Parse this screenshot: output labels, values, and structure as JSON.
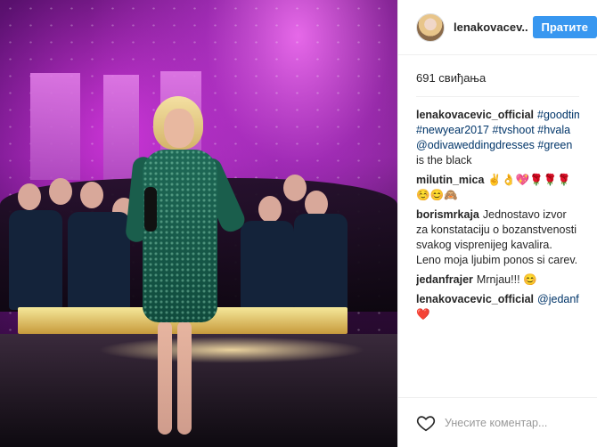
{
  "header": {
    "username": "lenakovacev...",
    "follow_label": "Пратите"
  },
  "likes_text": "691 свиђања",
  "comments": [
    {
      "user": "lenakovacevic_official",
      "parts": [
        {
          "t": "tag",
          "v": "#goodtimes"
        },
        {
          "t": "tag",
          "v": "#newyear2017"
        },
        {
          "t": "tag",
          "v": "#tvshoot"
        },
        {
          "t": "tag",
          "v": "#hvala"
        },
        {
          "t": "tag",
          "v": "@odivaweddingdresses"
        },
        {
          "t": "tag",
          "v": "#green"
        },
        {
          "t": "text",
          "v": "is the black"
        }
      ]
    },
    {
      "user": "milutin_mica",
      "parts": [
        {
          "t": "text",
          "v": "✌️👌💖🌹🌹🌹☺️😊🙈"
        }
      ]
    },
    {
      "user": "borismrkaja",
      "parts": [
        {
          "t": "text",
          "v": "Jednostavo izvor za konstataciju o bozanstvenosti svakog visprenijeg kavalira. Leno moja ljubim ponos si carev."
        }
      ]
    },
    {
      "user": "jedanfrajer",
      "parts": [
        {
          "t": "text",
          "v": "Mrnjau!!! 😊"
        }
      ]
    },
    {
      "user": "lenakovacevic_official",
      "parts": [
        {
          "t": "tag",
          "v": "@jedanfrajer"
        },
        {
          "t": "text",
          "v": "❤️"
        }
      ]
    }
  ],
  "add_comment_placeholder": "Унесите коментар...",
  "colors": {
    "follow_button": "#3897f0",
    "tag_link": "#003569"
  },
  "icons": {
    "like": "heart-outline-icon",
    "avatar": "profile-avatar"
  }
}
